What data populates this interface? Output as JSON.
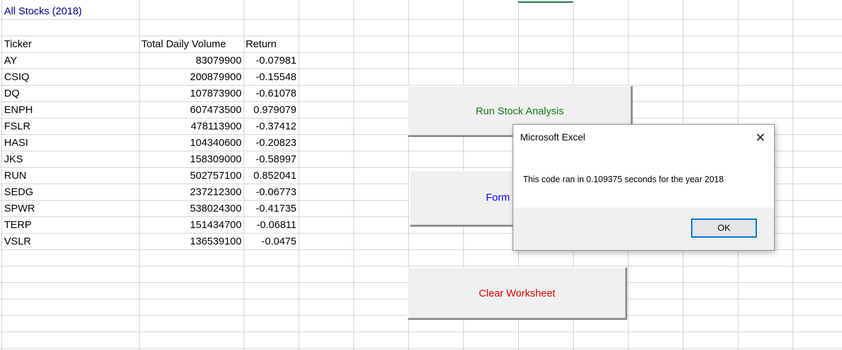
{
  "sheet": {
    "title": "All Stocks (2018)",
    "headers": {
      "ticker": "Ticker",
      "volume": "Total Daily Volume",
      "return": "Return"
    },
    "rows": [
      {
        "ticker": "AY",
        "volume": "83079900",
        "return": "-0.07981"
      },
      {
        "ticker": "CSIQ",
        "volume": "200879900",
        "return": "-0.15548"
      },
      {
        "ticker": "DQ",
        "volume": "107873900",
        "return": "-0.61078"
      },
      {
        "ticker": "ENPH",
        "volume": "607473500",
        "return": "0.979079"
      },
      {
        "ticker": "FSLR",
        "volume": "478113900",
        "return": "-0.37412"
      },
      {
        "ticker": "HASI",
        "volume": "104340600",
        "return": "-0.20823"
      },
      {
        "ticker": "JKS",
        "volume": "158309000",
        "return": "-0.58997"
      },
      {
        "ticker": "RUN",
        "volume": "502757100",
        "return": "0.852041"
      },
      {
        "ticker": "SEDG",
        "volume": "237212300",
        "return": "-0.06773"
      },
      {
        "ticker": "SPWR",
        "volume": "538024300",
        "return": "-0.41735"
      },
      {
        "ticker": "TERP",
        "volume": "151434700",
        "return": "-0.06811"
      },
      {
        "ticker": "VSLR",
        "volume": "136539100",
        "return": "-0.0475"
      }
    ]
  },
  "buttons": {
    "run_label": "Run Stock Analysis",
    "run_color": "#107c10",
    "format_label": "Form",
    "format_color": "#0000ff",
    "clear_label": "Clear Worksheet",
    "clear_color": "#e00000"
  },
  "dialog": {
    "title": "Microsoft Excel",
    "message": "This code ran in 0.109375 seconds for the year 2018",
    "ok_label": "OK",
    "close_icon": "close-icon"
  },
  "colors": {
    "gridline": "#d4d4d4",
    "title_text": "#000080",
    "ok_border": "#0078d7"
  }
}
